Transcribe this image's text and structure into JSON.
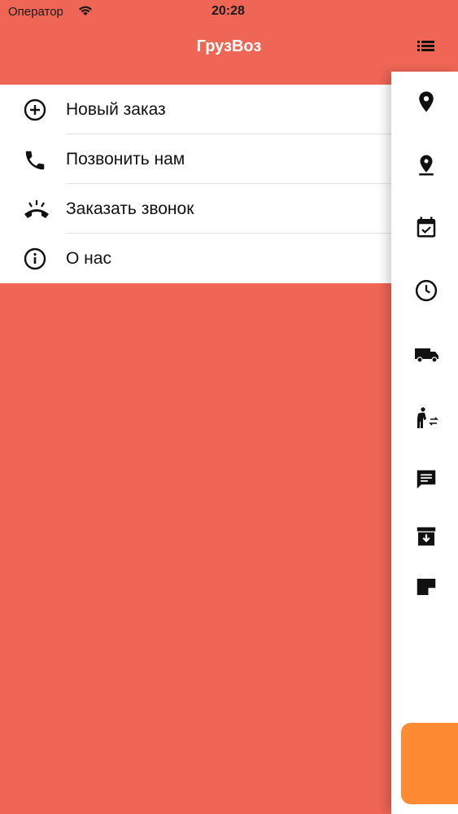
{
  "status_bar": {
    "carrier": "Оператор",
    "time": "20:28"
  },
  "header": {
    "title": "ГрузВоз"
  },
  "menu": {
    "items": [
      {
        "label": "Новый заказ",
        "icon": "add-circle-icon"
      },
      {
        "label": "Позвонить нам",
        "icon": "phone-icon"
      },
      {
        "label": "Заказать звонок",
        "icon": "call-end-icon"
      },
      {
        "label": "О нас",
        "icon": "info-icon"
      }
    ]
  },
  "sidebar": {
    "icons": [
      "menu-list-icon",
      "place-icon",
      "pin-drop-icon",
      "event-available-icon",
      "clock-icon",
      "truck-icon",
      "transfer-person-icon",
      "chat-icon",
      "archive-icon",
      "note-icon"
    ]
  },
  "colors": {
    "brand": "#EF6654",
    "accent": "#FF8A34",
    "panel": "#FFFFFF"
  }
}
